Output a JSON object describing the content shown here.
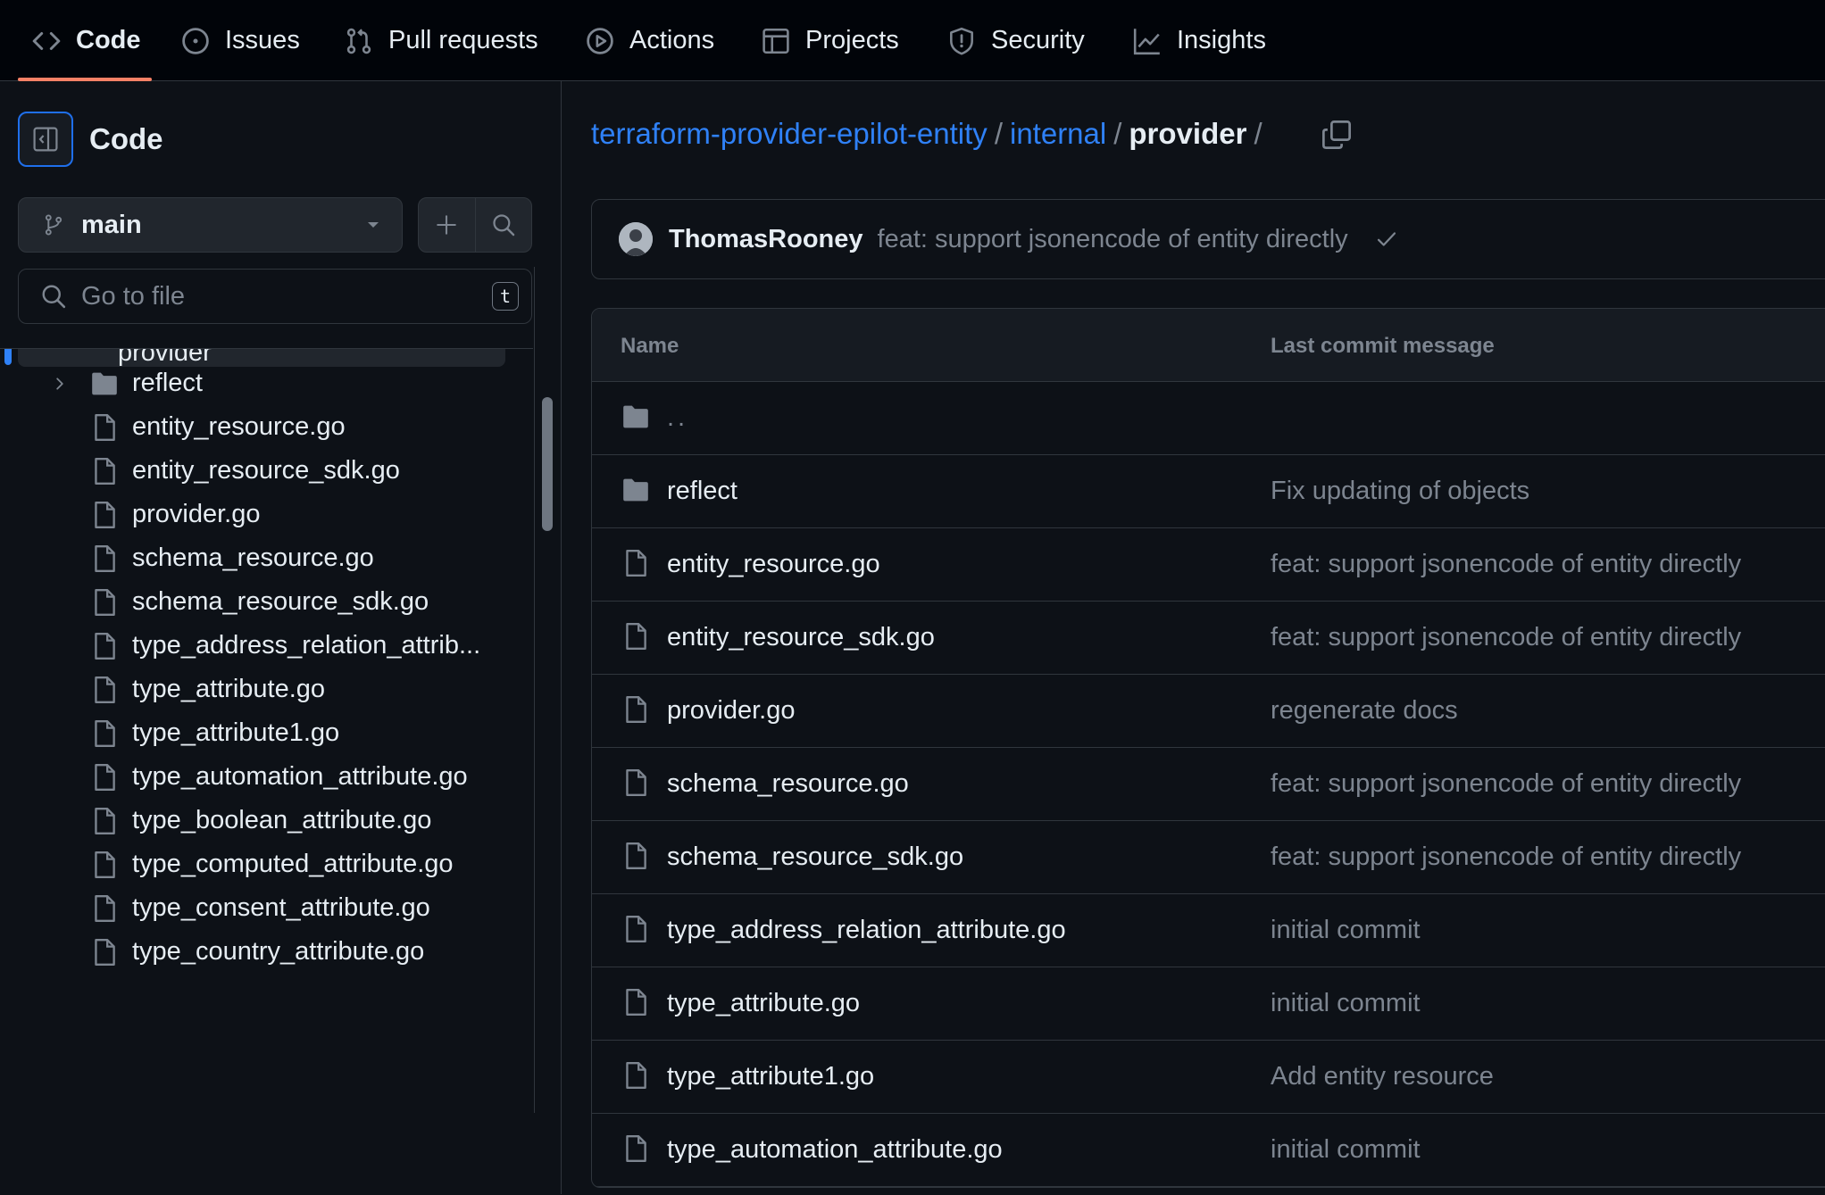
{
  "nav": {
    "tabs": [
      {
        "label": "Code",
        "icon": "code-icon",
        "selected": true
      },
      {
        "label": "Issues",
        "icon": "issue-icon"
      },
      {
        "label": "Pull requests",
        "icon": "pull-request-icon"
      },
      {
        "label": "Actions",
        "icon": "play-icon"
      },
      {
        "label": "Projects",
        "icon": "table-icon"
      },
      {
        "label": "Security",
        "icon": "shield-icon"
      },
      {
        "label": "Insights",
        "icon": "graph-icon"
      }
    ]
  },
  "sidebar": {
    "title": "Code",
    "branch": "main",
    "search_placeholder": "Go to file",
    "search_shortcut": "t",
    "partial_item": "provider",
    "tree": [
      {
        "name": "reflect",
        "type": "folder"
      },
      {
        "name": "entity_resource.go",
        "type": "file"
      },
      {
        "name": "entity_resource_sdk.go",
        "type": "file"
      },
      {
        "name": "provider.go",
        "type": "file"
      },
      {
        "name": "schema_resource.go",
        "type": "file"
      },
      {
        "name": "schema_resource_sdk.go",
        "type": "file"
      },
      {
        "name": "type_address_relation_attrib...",
        "type": "file"
      },
      {
        "name": "type_attribute.go",
        "type": "file"
      },
      {
        "name": "type_attribute1.go",
        "type": "file"
      },
      {
        "name": "type_automation_attribute.go",
        "type": "file"
      },
      {
        "name": "type_boolean_attribute.go",
        "type": "file"
      },
      {
        "name": "type_computed_attribute.go",
        "type": "file"
      },
      {
        "name": "type_consent_attribute.go",
        "type": "file"
      },
      {
        "name": "type_country_attribute.go",
        "type": "file"
      }
    ]
  },
  "breadcrumb": {
    "repo": "terraform-provider-epilot-entity",
    "folder": "internal",
    "current": "provider",
    "sep": "/"
  },
  "commit": {
    "author": "ThomasRooney",
    "message": "feat: support jsonencode of entity directly"
  },
  "table": {
    "col_name": "Name",
    "col_message": "Last commit message",
    "parent_dir": "..",
    "rows": [
      {
        "name": "reflect",
        "type": "folder",
        "message": "Fix updating of objects"
      },
      {
        "name": "entity_resource.go",
        "type": "file",
        "message": "feat: support jsonencode of entity directly"
      },
      {
        "name": "entity_resource_sdk.go",
        "type": "file",
        "message": "feat: support jsonencode of entity directly"
      },
      {
        "name": "provider.go",
        "type": "file",
        "message": "regenerate docs"
      },
      {
        "name": "schema_resource.go",
        "type": "file",
        "message": "feat: support jsonencode of entity directly"
      },
      {
        "name": "schema_resource_sdk.go",
        "type": "file",
        "message": "feat: support jsonencode of entity directly"
      },
      {
        "name": "type_address_relation_attribute.go",
        "type": "file",
        "message": "initial commit"
      },
      {
        "name": "type_attribute.go",
        "type": "file",
        "message": "initial commit"
      },
      {
        "name": "type_attribute1.go",
        "type": "file",
        "message": "Add entity resource"
      },
      {
        "name": "type_automation_attribute.go",
        "type": "file",
        "message": "initial commit"
      }
    ]
  },
  "colors": {
    "accent": "#2f81f7",
    "underline": "#f78166",
    "background": "#0d1117"
  }
}
